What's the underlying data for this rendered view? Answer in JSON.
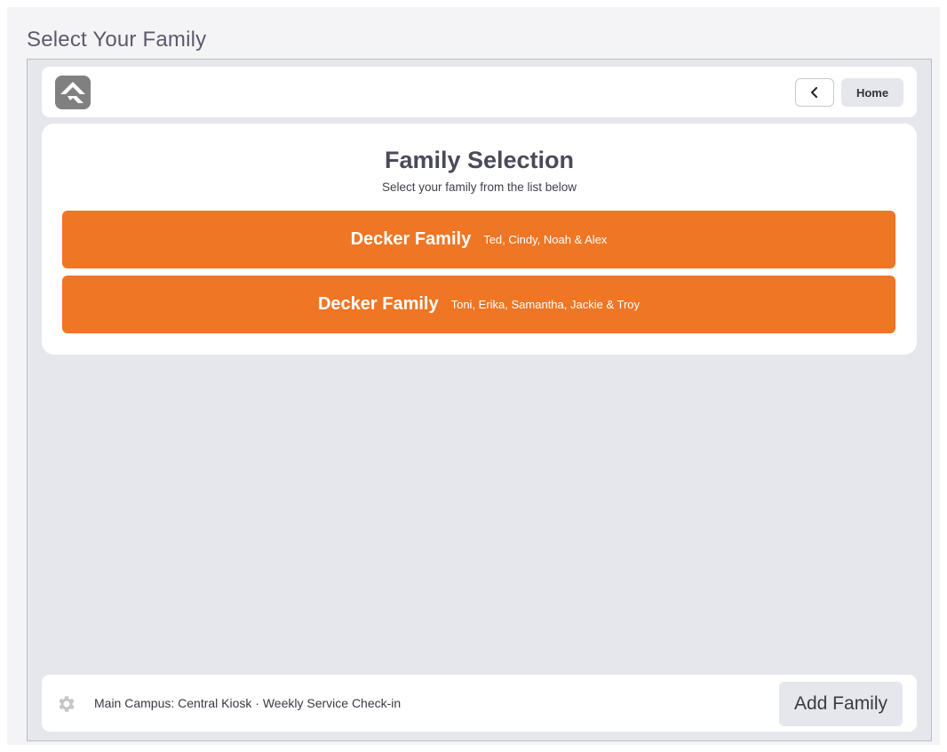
{
  "page": {
    "heading": "Select Your Family"
  },
  "header": {
    "logo_icon": "rock-logo-icon",
    "back_icon": "chevron-left-icon",
    "home_label": "Home"
  },
  "panel": {
    "title": "Family Selection",
    "subtitle": "Select your family from the list below",
    "families": [
      {
        "name": "Decker Family",
        "members": "Ted, Cindy, Noah & Alex"
      },
      {
        "name": "Decker Family",
        "members": "Toni, Erika, Samantha, Jackie & Troy"
      }
    ]
  },
  "footer": {
    "settings_icon": "gear-icon",
    "kiosk_info": "Main Campus: Central Kiosk · Weekly Service Check-in",
    "add_family_label": "Add Family"
  },
  "colors": {
    "accent": "#ee7624",
    "frame_bg": "#e6e7ec",
    "panel_bg": "#ffffff",
    "title_text": "#4a4a5a"
  }
}
